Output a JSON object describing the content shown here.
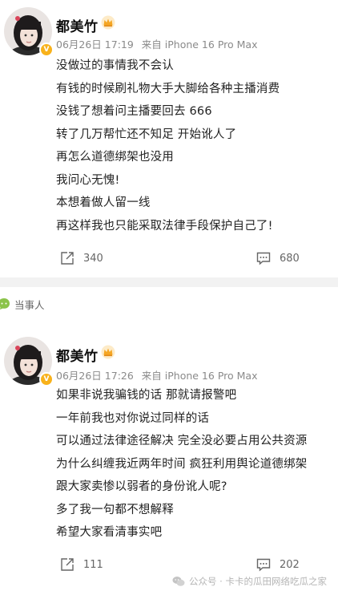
{
  "posts": [
    {
      "author": "都美竹",
      "date": "06月26日 17:19",
      "source": "来自 iPhone 16 Pro Max",
      "lines": [
        "没做过的事情我不会认",
        "有钱的时候刷礼物大手大脚给各种主播消费",
        "没钱了想着问主播要回去 666",
        "转了几万帮忙还不知足 开始讹人了",
        "再怎么道德绑架也没用",
        "我问心无愧!",
        "本想着做人留一线",
        "再这样我也只能采取法律手段保护自己了!"
      ],
      "share_count": "340",
      "comment_count": "680"
    },
    {
      "author": "都美竹",
      "date": "06月26日 17:26",
      "source": "来自 iPhone 16 Pro Max",
      "lines": [
        "如果非说我骗钱的话 那就请报警吧",
        "一年前我也对你说过同样的话",
        "可以通过法律途径解决 完全没必要占用公共资源",
        "为什么纠缠我近两年时间 疯狂利用舆论道德绑架",
        "跟大家卖惨以弱者的身份讹人呢?",
        "多了我一句都不想解释",
        "希望大家看清事实吧"
      ],
      "share_count": "111",
      "comment_count": "202"
    }
  ],
  "section_label": "当事人",
  "watermark": "公众号 · 卡卡的瓜田网络吃瓜之家",
  "colors": {
    "verified": "#f8b21b",
    "crown": "#f5a623",
    "label_icon": "#8bc34a"
  }
}
